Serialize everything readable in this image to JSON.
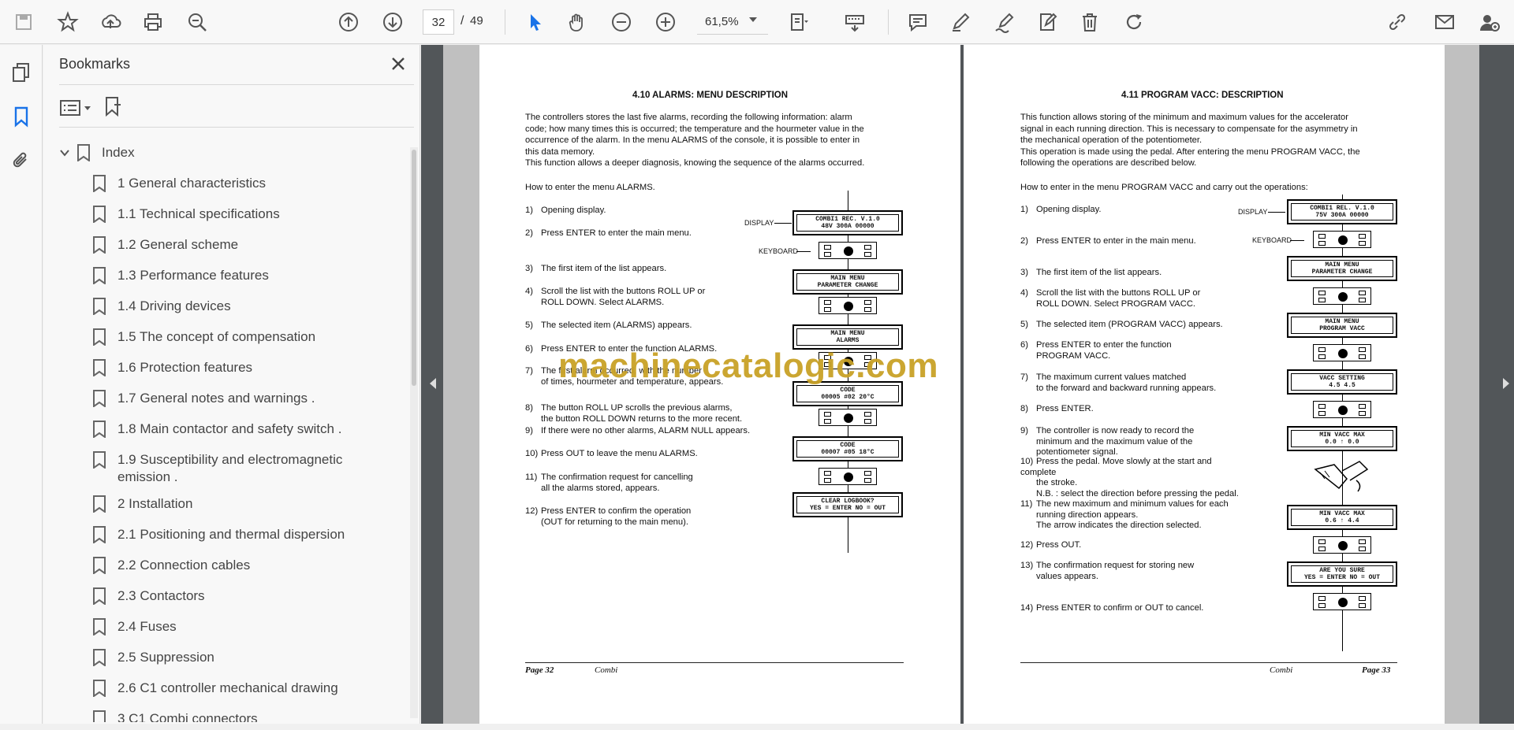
{
  "toolbar": {
    "page_current": "32",
    "page_separator": "/",
    "page_total": "49",
    "zoom": "61,5%"
  },
  "bookmarks": {
    "title": "Bookmarks",
    "root": "Index",
    "items": [
      {
        "label": "1 General characteristics"
      },
      {
        "label": "1.1 Technical specifications"
      },
      {
        "label": "1.2 General scheme"
      },
      {
        "label": "1.3 Performance features"
      },
      {
        "label": "1.4 Driving devices"
      },
      {
        "label": "1.5 The concept of compensation"
      },
      {
        "label": "1.6 Protection features"
      },
      {
        "label": "1.7 General notes and warnings      ."
      },
      {
        "label": "1.8 Main contactor and safety switch      ."
      },
      {
        "label": "1.9 Susceptibility and electromagnetic",
        "label2": "emission      ."
      },
      {
        "label": "2 Installation"
      },
      {
        "label": "2.1 Positioning and thermal dispersion"
      },
      {
        "label": "2.2 Connection cables"
      },
      {
        "label": "2.3 Contactors"
      },
      {
        "label": "2.4 Fuses"
      },
      {
        "label": "2.5 Suppression"
      },
      {
        "label": "2.6 C1 controller mechanical drawing"
      },
      {
        "label": "3 C1 Combi connectors"
      }
    ]
  },
  "watermark": "machinecatalogic.com",
  "page_left": {
    "title": "4.10 ALARMS: MENU DESCRIPTION",
    "intro": [
      "The controllers stores the last five alarms, recording the following information: alarm",
      "code; how many times this is occurred; the temperature and the hourmeter value in the",
      "occurrence of the alarm. In the menu ALARMS of the console, it is possible to enter in",
      "this data memory.",
      "This function allows a deeper diagnosis, knowing the sequence of the alarms occurred."
    ],
    "howto": "How to enter the menu ALARMS.",
    "steps": [
      {
        "n": "1)",
        "lines": [
          "Opening display."
        ]
      },
      {
        "n": "2)",
        "lines": [
          "Press ENTER to enter the main menu."
        ]
      },
      {
        "n": "3)",
        "lines": [
          "The first item of the list appears."
        ]
      },
      {
        "n": "4)",
        "lines": [
          "Scroll the list with the buttons ROLL UP or",
          "ROLL DOWN. Select ALARMS."
        ]
      },
      {
        "n": "5)",
        "lines": [
          "The selected item (ALARMS) appears."
        ]
      },
      {
        "n": "6)",
        "lines": [
          "Press ENTER to enter the function ALARMS."
        ]
      },
      {
        "n": "7)",
        "lines": [
          "The first alarm occurred, with the number",
          "of times, hourmeter and temperature, appears."
        ]
      },
      {
        "n": "8)",
        "lines": [
          "The button ROLL UP scrolls the previous alarms,",
          "the button ROLL DOWN returns to the more recent."
        ]
      },
      {
        "n": "9)",
        "lines": [
          "If there were no other alarms, ALARM NULL appears."
        ]
      },
      {
        "n": "10)",
        "lines": [
          "Press OUT to leave the menu ALARMS."
        ]
      },
      {
        "n": "11)",
        "lines": [
          "The confirmation request for cancelling",
          "all the alarms stored, appears."
        ]
      },
      {
        "n": "12)",
        "lines": [
          "Press ENTER to confirm the operation",
          "(OUT for returning to the main menu)."
        ]
      }
    ],
    "display_tag": "DISPLAY",
    "keyboard_tag": "KEYBOARD",
    "lcds": [
      [
        "COMBI1 REC. V.1.0",
        "48V 300A 00000"
      ],
      [
        "MAIN MENU",
        "PARAMETER CHANGE"
      ],
      [
        "MAIN MENU",
        "ALARMS"
      ],
      [
        "CODE",
        "00005 #02 20°C"
      ],
      [
        "CODE",
        "00007 #05 18°C"
      ],
      [
        "CLEAR LOGBOOK?",
        "YES = ENTER NO = OUT"
      ]
    ],
    "footer_page": "Page 32",
    "footer_name": "Combi"
  },
  "page_right": {
    "title": "4.11 PROGRAM VACC: DESCRIPTION",
    "intro": [
      "This function allows storing of the minimum and maximum values for the accelerator",
      "signal in each running direction. This is necessary to compensate for the asymmetry in",
      "the mechanical operation of the potentiometer.",
      "This operation is made using the pedal. After entering the menu PROGRAM VACC, the",
      "following the operations are described below."
    ],
    "howto": "How to enter in the menu PROGRAM VACC and carry out the operations:",
    "steps": [
      {
        "n": "1)",
        "lines": [
          "Opening display."
        ]
      },
      {
        "n": "2)",
        "lines": [
          "Press ENTER to enter in the main menu."
        ]
      },
      {
        "n": "3)",
        "lines": [
          "The first item of the list appears."
        ]
      },
      {
        "n": "4)",
        "lines": [
          "Scroll the list with the buttons ROLL UP or",
          "ROLL DOWN. Select PROGRAM VACC."
        ]
      },
      {
        "n": "5)",
        "lines": [
          "The selected item (PROGRAM VACC) appears."
        ]
      },
      {
        "n": "6)",
        "lines": [
          "Press ENTER to enter the function",
          "PROGRAM VACC."
        ]
      },
      {
        "n": "7)",
        "lines": [
          "The maximum current values matched",
          "to the forward and backward running appears."
        ]
      },
      {
        "n": "8)",
        "lines": [
          "Press ENTER."
        ]
      },
      {
        "n": "9)",
        "lines": [
          "The controller is now ready to record the",
          "minimum and the maximum value of the",
          "potentiometer signal."
        ]
      },
      {
        "n": "10)",
        "lines": [
          "Press the pedal. Move slowly at the start and complete",
          "the stroke.",
          "N.B. : select the direction before pressing the pedal."
        ]
      },
      {
        "n": "11)",
        "lines": [
          "The new maximum and minimum values for each",
          "running direction appears.",
          "The arrow indicates the direction selected."
        ]
      },
      {
        "n": "12)",
        "lines": [
          "Press OUT."
        ]
      },
      {
        "n": "13)",
        "lines": [
          "The confirmation request for storing new",
          "values appears."
        ]
      },
      {
        "n": "14)",
        "lines": [
          "Press ENTER to confirm or OUT to cancel."
        ]
      }
    ],
    "display_tag": "DISPLAY",
    "keyboard_tag": "KEYBOARD",
    "lcds": [
      [
        "COMBI1 REL. V.1.0",
        "75V 300A 00000"
      ],
      [
        "MAIN MENU",
        "PARAMETER CHANGE"
      ],
      [
        "MAIN MENU",
        "PROGRAM VACC"
      ],
      [
        "VACC SETTING",
        "4.5        4.5"
      ],
      [
        "MIN    VACC    MAX",
        "0.0    ↑     0.0"
      ],
      [
        "MIN    VACC    MAX",
        "0.6    ↑     4.4"
      ],
      [
        "ARE YOU SURE",
        "YES = ENTER NO = OUT"
      ]
    ],
    "footer_page": "Page 33",
    "footer_name": "Combi"
  }
}
